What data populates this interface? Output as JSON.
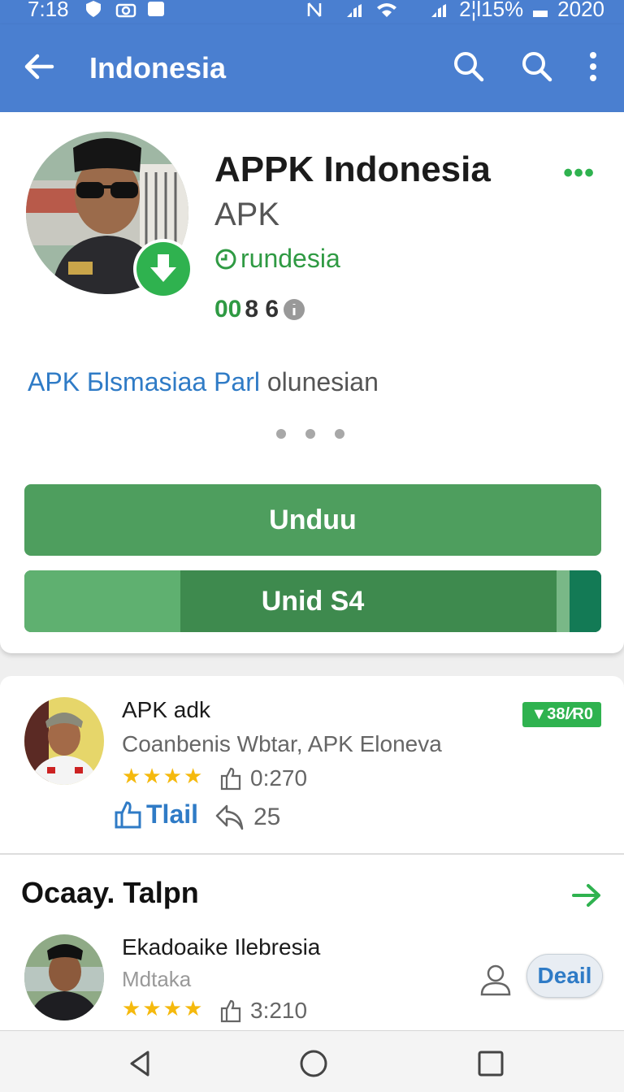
{
  "status_bar": {
    "time": "7:18",
    "right_text": "2¦l15%",
    "right_text2": "2020"
  },
  "app_bar": {
    "title": "Indonesia",
    "back_icon": "arrow-left-icon",
    "search_icon": "search-icon",
    "more_icon": "more-vert-icon"
  },
  "app_header": {
    "name": "APPK Indonesia",
    "subtitle": "APK",
    "developer": "rundesia",
    "developer_prefix_symbol": "⏲",
    "count_green": "00",
    "count_rest": "8 6",
    "more_label": "•••"
  },
  "description": {
    "link_text": "APK Бlsmasiaa Parl",
    "rest_text": " olunesian"
  },
  "buttons": {
    "download_label": "Unduu",
    "progress_label": "Unid S4",
    "progress_fraction": 0.27
  },
  "review": {
    "title": "APK adk",
    "subtitle": "Coanbenis Wbtar, APK Eloneva",
    "stars": 4,
    "stat_value": "0:270",
    "badge": "▼38/⁄R0",
    "like_label": "Tlail",
    "reply_count": "25"
  },
  "section": {
    "title": "Ocaay. Talpn"
  },
  "item": {
    "title": "Ekadoaike Ilebresia",
    "subtitle": "Mdtaka",
    "stars": 4,
    "stat_value": "3:210",
    "detail_label": "Deail"
  },
  "colors": {
    "app_bar": "#4a7fd0",
    "primary_green": "#4e9e5e",
    "accent_green": "#2fb24f",
    "link_blue": "#2f7bc6",
    "star": "#f5b90d"
  }
}
